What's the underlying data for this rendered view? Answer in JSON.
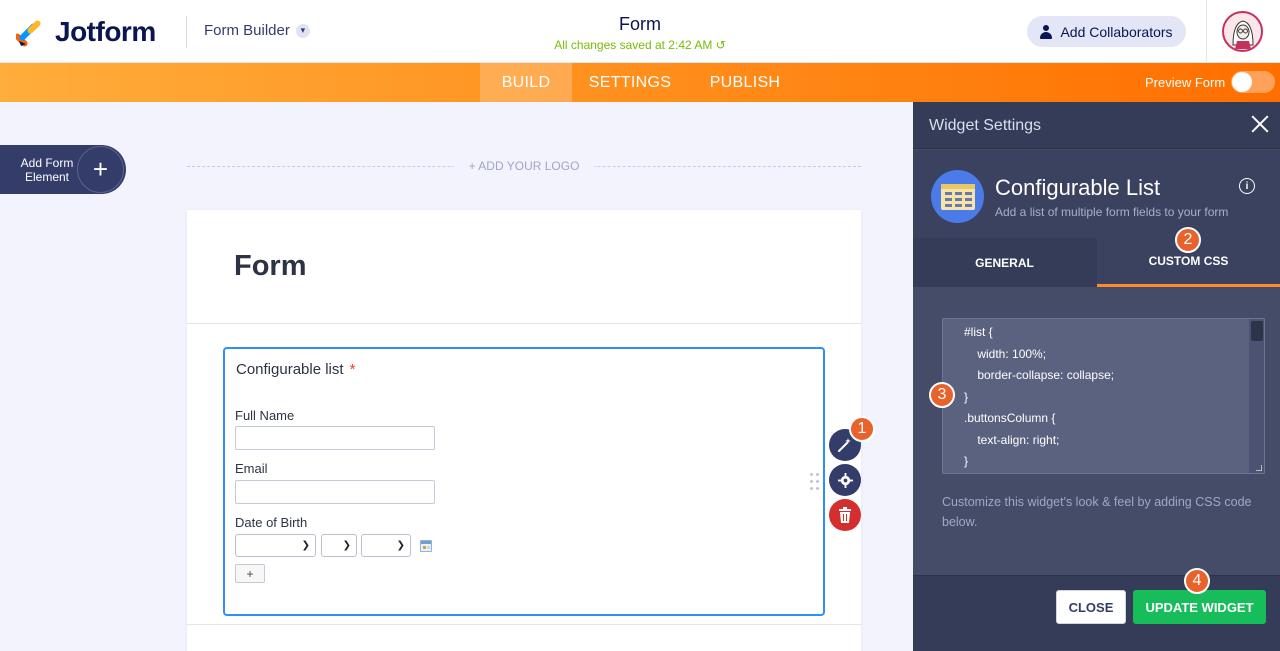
{
  "brand": {
    "name": "Jotform"
  },
  "header": {
    "builder_label": "Form Builder",
    "form_title": "Form",
    "save_status": "All changes saved at 2:42 AM",
    "collaborators_label": "Add Collaborators"
  },
  "nav": {
    "tabs": [
      {
        "label": "BUILD",
        "active": true
      },
      {
        "label": "SETTINGS",
        "active": false
      },
      {
        "label": "PUBLISH",
        "active": false
      }
    ],
    "preview_label": "Preview Form",
    "preview_enabled": false
  },
  "builder": {
    "add_element_label": "Add Form Element",
    "add_logo_label": "+ ADD YOUR LOGO",
    "form_heading": "Form",
    "field": {
      "label": "Configurable list",
      "required_mark": "*",
      "sub_fields": [
        {
          "label": "Full Name"
        },
        {
          "label": "Email"
        },
        {
          "label": "Date of Birth"
        }
      ],
      "add_row_label": "+"
    }
  },
  "panel": {
    "title": "Widget Settings",
    "widget_name": "Configurable List",
    "widget_description": "Add a list of multiple form fields to your form",
    "tabs": [
      {
        "label": "GENERAL",
        "active": false
      },
      {
        "label": "CUSTOM CSS",
        "active": true
      }
    ],
    "css_lines": [
      "#list {",
      "    width: 100%;",
      "    border-collapse: collapse;",
      "}",
      ".buttonsColumn {",
      "    text-align: right;",
      "}"
    ],
    "help_text": "Customize this widget's look & feel by adding CSS code below.",
    "close_label": "CLOSE",
    "update_label": "UPDATE WIDGET"
  },
  "step_badges": [
    "1",
    "2",
    "3",
    "4"
  ],
  "colors": {
    "brand_navy": "#0a1551",
    "nav_orange": "#ff8f1c",
    "focus_blue": "#2e8ff5",
    "update_green": "#18bd5b",
    "badge_orange": "#e8622c",
    "saved_green": "#78bb07"
  },
  "icons": {
    "logo": "jotform-logo-icon",
    "collaborator": "user-icon",
    "refresh": "refresh-icon",
    "chevron": "chevron-down-icon",
    "wand": "magic-wand-icon",
    "gear": "gear-icon",
    "trash": "trash-icon",
    "calendar": "calendar-icon",
    "info": "info-icon",
    "close": "close-icon",
    "widget": "configurable-list-icon"
  }
}
